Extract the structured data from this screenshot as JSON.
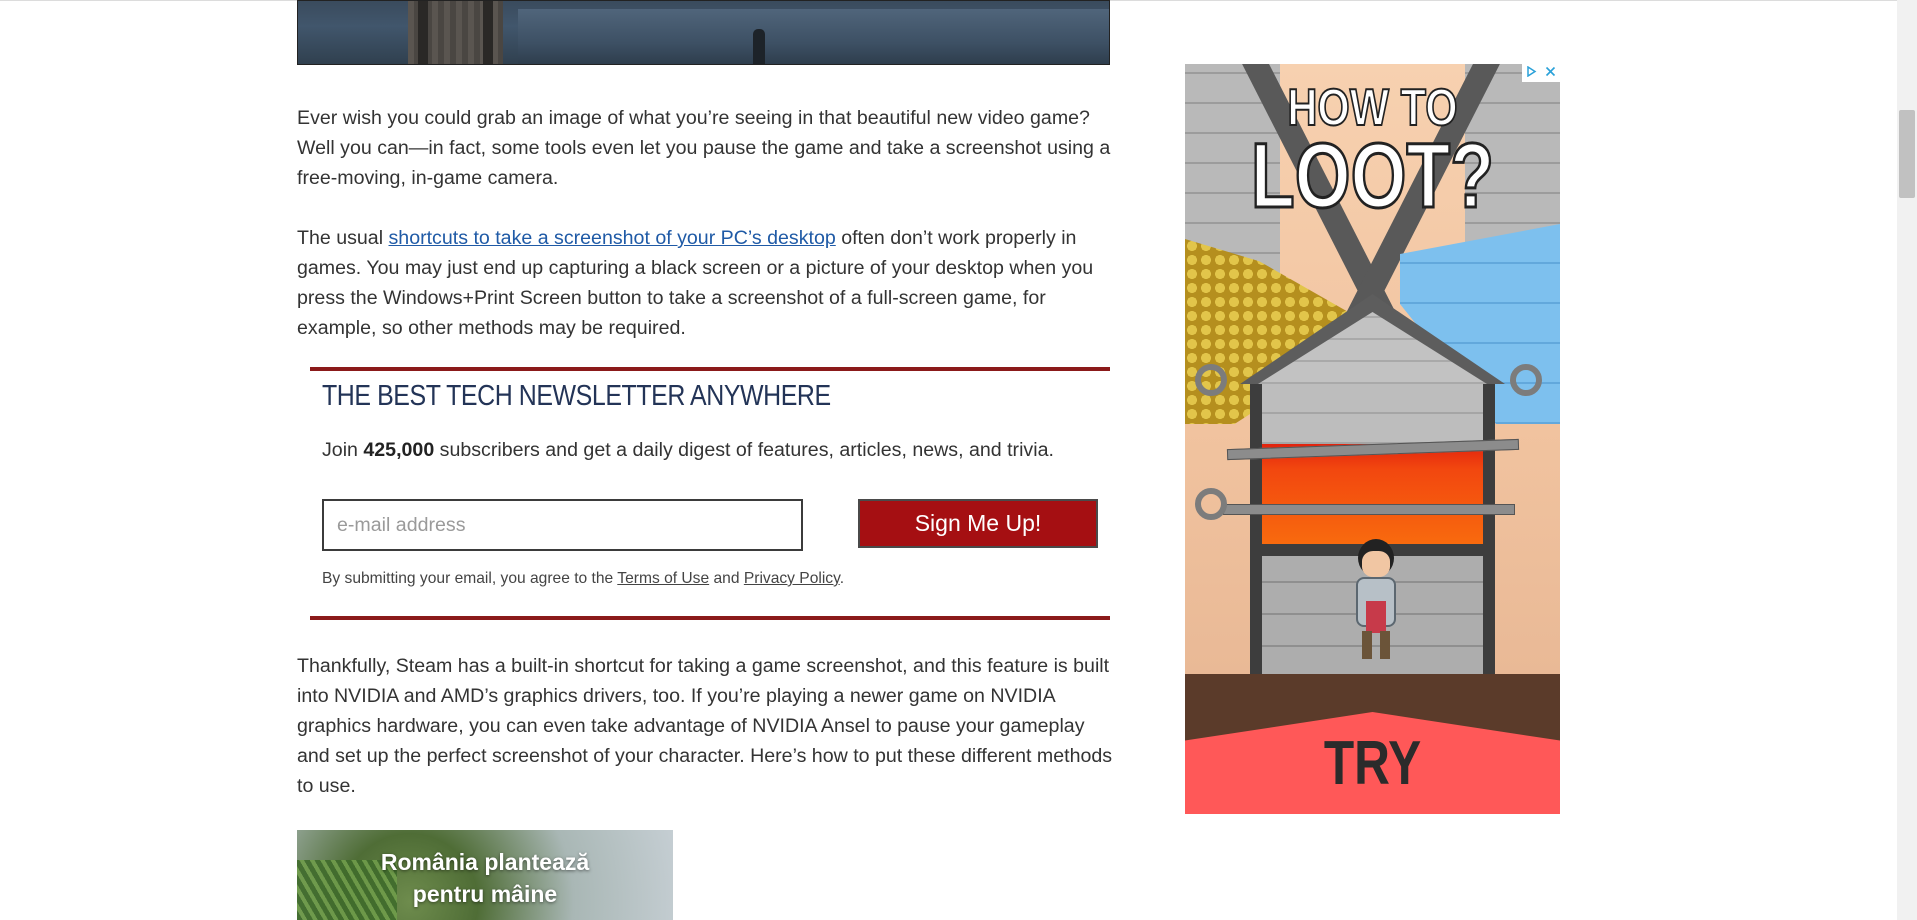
{
  "article": {
    "para1": "Ever wish you could grab an image of what you’re seeing in that beautiful new video game? Well you can—in fact, some tools even let you pause the game and take a screenshot using a free-moving, in-game camera.",
    "para2_before": "The usual ",
    "para2_link": "shortcuts to take a screenshot of your PC’s desktop",
    "para2_after": " often don’t work properly in games. You may just end up capturing a black screen or a picture of your desktop when you press the Windows+Print Screen button to take a screenshot of a full-screen game, for example, so other methods may be required.",
    "para3": "Thankfully, Steam has a built-in shortcut for taking a game screenshot, and this feature is built into NVIDIA and AMD’s graphics drivers, too. If you’re playing a newer game on NVIDIA graphics hardware, you can even take advantage of NVIDIA Ansel to pause your gameplay and set up the perfect screenshot of your character. Here’s how to put these different methods to use."
  },
  "newsletter": {
    "title": "THE BEST TECH NEWSLETTER ANYWHERE",
    "desc_before": "Join ",
    "desc_count": "425,000",
    "desc_after": " subscribers and get a daily digest of features, articles, news, and trivia.",
    "email_placeholder": "e-mail address",
    "button_label": "Sign Me Up!",
    "legal_before": "By submitting your email, you agree to the ",
    "terms_link": "Terms of Use",
    "legal_and": " and ",
    "privacy_link": "Privacy Policy",
    "legal_end": "."
  },
  "promo": {
    "line1": "România plantează",
    "line2": "pentru mâine"
  },
  "ad": {
    "headline_1": "HOW TO",
    "headline_2": "LOOT?",
    "cta": "TRY",
    "choices_icon": "adchoices-icon",
    "close_icon": "close-icon"
  },
  "colors": {
    "link": "#1f5aa6",
    "newsletter_rule": "#8b1a1a",
    "newsletter_title": "#233457",
    "signup_button": "#a50f12",
    "ad_cta_band": "#ff5858"
  }
}
